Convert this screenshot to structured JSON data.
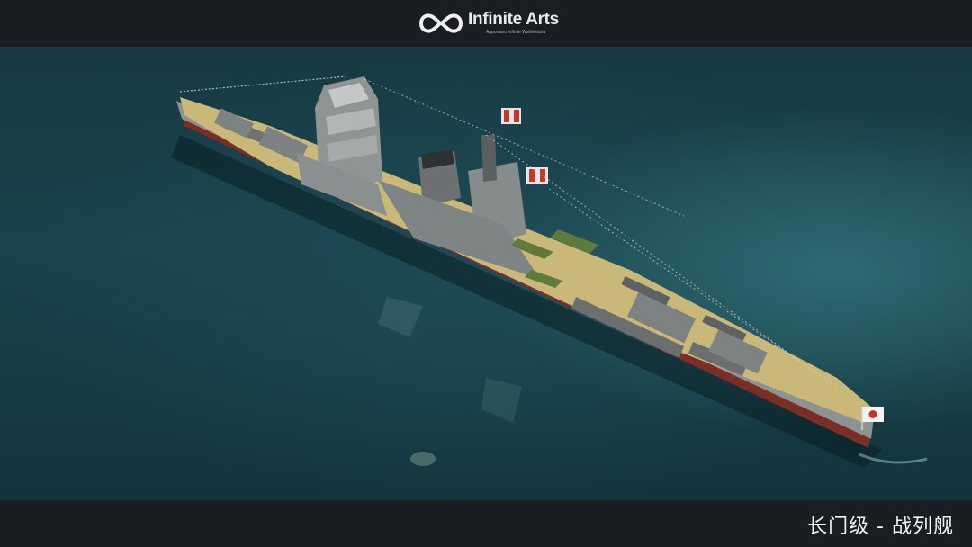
{
  "header": {
    "logo_name": "Infinite Arts",
    "logo_tagline": "Apportano infinite Wahlelitaria"
  },
  "footer": {
    "caption": "长门级 - 战列舰"
  },
  "scene": {
    "subject": "battleship",
    "flag": "japan-flag-icon"
  }
}
